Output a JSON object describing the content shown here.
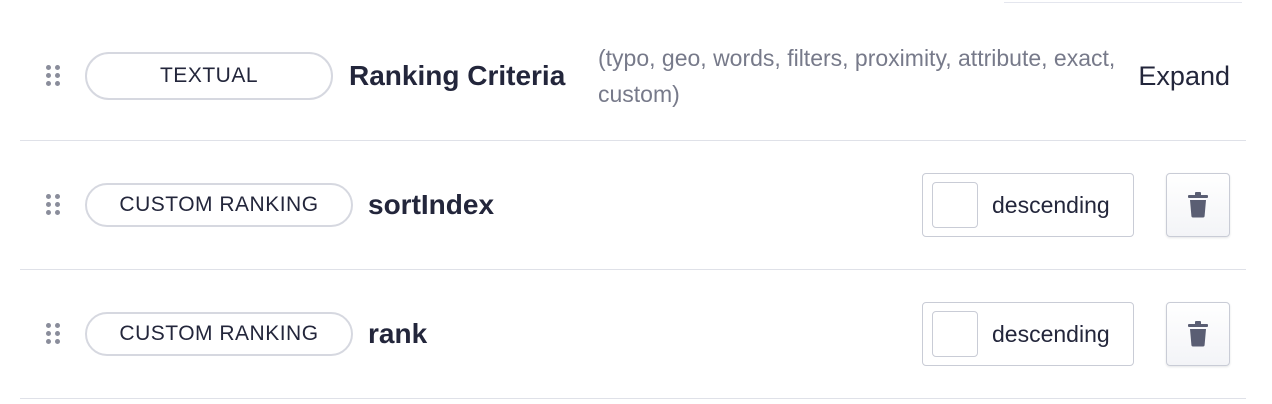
{
  "rows": [
    {
      "tag": "TEXTUAL",
      "name": "Ranking Criteria",
      "hint": "(typo, geo, words, filters, proximity, attribute, exact, custom)",
      "action": "Expand"
    },
    {
      "tag": "CUSTOM RANKING",
      "name": "sortIndex",
      "order": "descending"
    },
    {
      "tag": "CUSTOM RANKING",
      "name": "rank",
      "order": "descending"
    }
  ],
  "icons": {
    "handle": "drag-handle-icon",
    "delete": "trash-icon"
  },
  "colors": {
    "text": "#23263b",
    "muted": "#777a8a",
    "border": "#d6d8e0",
    "icon": "#5a5e73"
  }
}
